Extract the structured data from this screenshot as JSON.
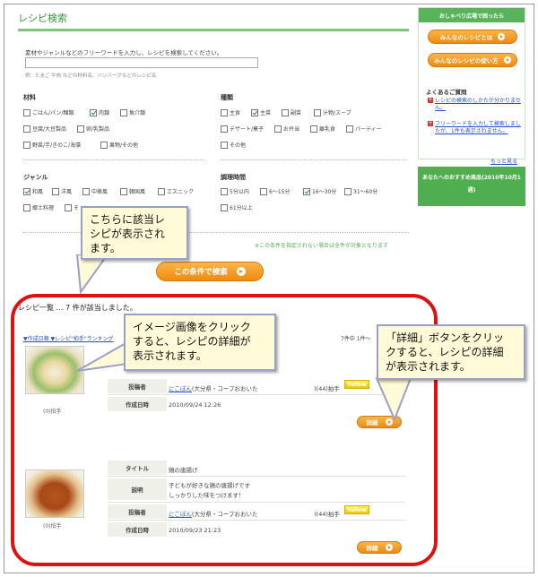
{
  "search": {
    "title": "レシピ検索",
    "intro": "素材やジャンルなどのフリーワードを入力し、レシピを検索してください。",
    "keyword_value": "",
    "example": "例：たまご 牛肉 などの材料名、ハンバーグなどのレシピ名",
    "materials": {
      "heading": "材料",
      "items": [
        {
          "label": "ごはん/パン/麺類",
          "checked": false
        },
        {
          "label": "肉類",
          "checked": true
        },
        {
          "label": "魚介類",
          "checked": false
        },
        {
          "label": "豆腐/大豆製品",
          "checked": false
        },
        {
          "label": "卵/乳製品",
          "checked": false
        },
        {
          "label": "野菜/芋/きのこ/海藻",
          "checked": false
        },
        {
          "label": "果物/その他",
          "checked": false
        }
      ]
    },
    "types": {
      "heading": "種類",
      "items": [
        {
          "label": "主食",
          "checked": false
        },
        {
          "label": "主菜",
          "checked": true
        },
        {
          "label": "副菜",
          "checked": false
        },
        {
          "label": "汁物/スープ",
          "checked": false
        },
        {
          "label": "デザート/菓子",
          "checked": false
        },
        {
          "label": "お弁当",
          "checked": false
        },
        {
          "label": "離乳食",
          "checked": false
        },
        {
          "label": "パーティー",
          "checked": false
        },
        {
          "label": "その他",
          "checked": false
        }
      ]
    },
    "genres": {
      "heading": "ジャンル",
      "items": [
        {
          "label": "和風",
          "checked": true
        },
        {
          "label": "洋風",
          "checked": false
        },
        {
          "label": "中華風",
          "checked": false
        },
        {
          "label": "韓国風",
          "checked": false
        },
        {
          "label": "エスニック",
          "checked": false
        },
        {
          "label": "郷土料理",
          "checked": false
        },
        {
          "label": "そ",
          "checked": false
        }
      ]
    },
    "cook_time": {
      "heading": "調理時間",
      "items": [
        {
          "label": "5分以内",
          "checked": false
        },
        {
          "label": "6〜15分",
          "checked": false
        },
        {
          "label": "16〜30分",
          "checked": true
        },
        {
          "label": "31〜60分",
          "checked": false
        },
        {
          "label": "61分以上",
          "checked": false
        }
      ]
    },
    "note": "※この条件を指定されない場合は全件が対象となります",
    "search_button": "この条件で検索"
  },
  "sidebar": {
    "header": "おしゃべり広場で困ったら",
    "button1": "みんなのレシピとは",
    "button2": "みんなのレシピの使い方",
    "faq_title": "よくあるご質問",
    "faq1": "レシピの検索のしかたが分かりません。",
    "faq2": "フリーワードを入力して検索しましたが、1件も表示されません。",
    "more": "もっと見る",
    "featured_line1": "あなたへのおすすめ商品(2010年10月1",
    "featured_line2": "週)"
  },
  "results": {
    "summary": "レシピ一覧 … 7 件が該当しました。",
    "tab_links": "▼作成日順 ▼レシピ\"拍手\"ランキング",
    "page_info": "7件中 1件〜",
    "labels": {
      "title": "タイトル",
      "description": "説明",
      "author": "投稿者",
      "created": "作成日時"
    },
    "yellow_label": "Yellow",
    "detail_button": "詳細",
    "items": [
      {
        "claps": "(0)拍手",
        "author": "にこぽん",
        "author_place": "(大分県・コープおおいた",
        "author_claps": ")(44)拍手",
        "created": "2010/09/24 12:26"
      },
      {
        "claps": "(0)拍手",
        "title": "鶏の唐揚げ",
        "description_line1": "子どもが好きな鶏の唐揚げです",
        "description_line2": "しっかりした味をつけます！",
        "author": "にこぽん",
        "author_place": "(大分県・コープおおいた",
        "author_claps": ")(44)拍手",
        "created": "2010/09/23 21:23"
      }
    ]
  },
  "callouts": {
    "results_area_line1": "こちらに該当レ",
    "results_area_line2": "シピが表示され",
    "results_area_line3": "ます。",
    "image_line1": "イメージ画像をクリック",
    "image_line2": "すると、レシピの詳細が",
    "image_line3": "表示されます。",
    "detail_line1": "「詳細」ボタンをクリッ",
    "detail_line2": "クすると、レシピの詳細",
    "detail_line3": "が表示されます。"
  },
  "colors": {
    "accent_green": "#58b35a",
    "accent_orange": "#f08a10",
    "highlight_red": "#e01010",
    "callout_fill": "#fffbd8"
  }
}
